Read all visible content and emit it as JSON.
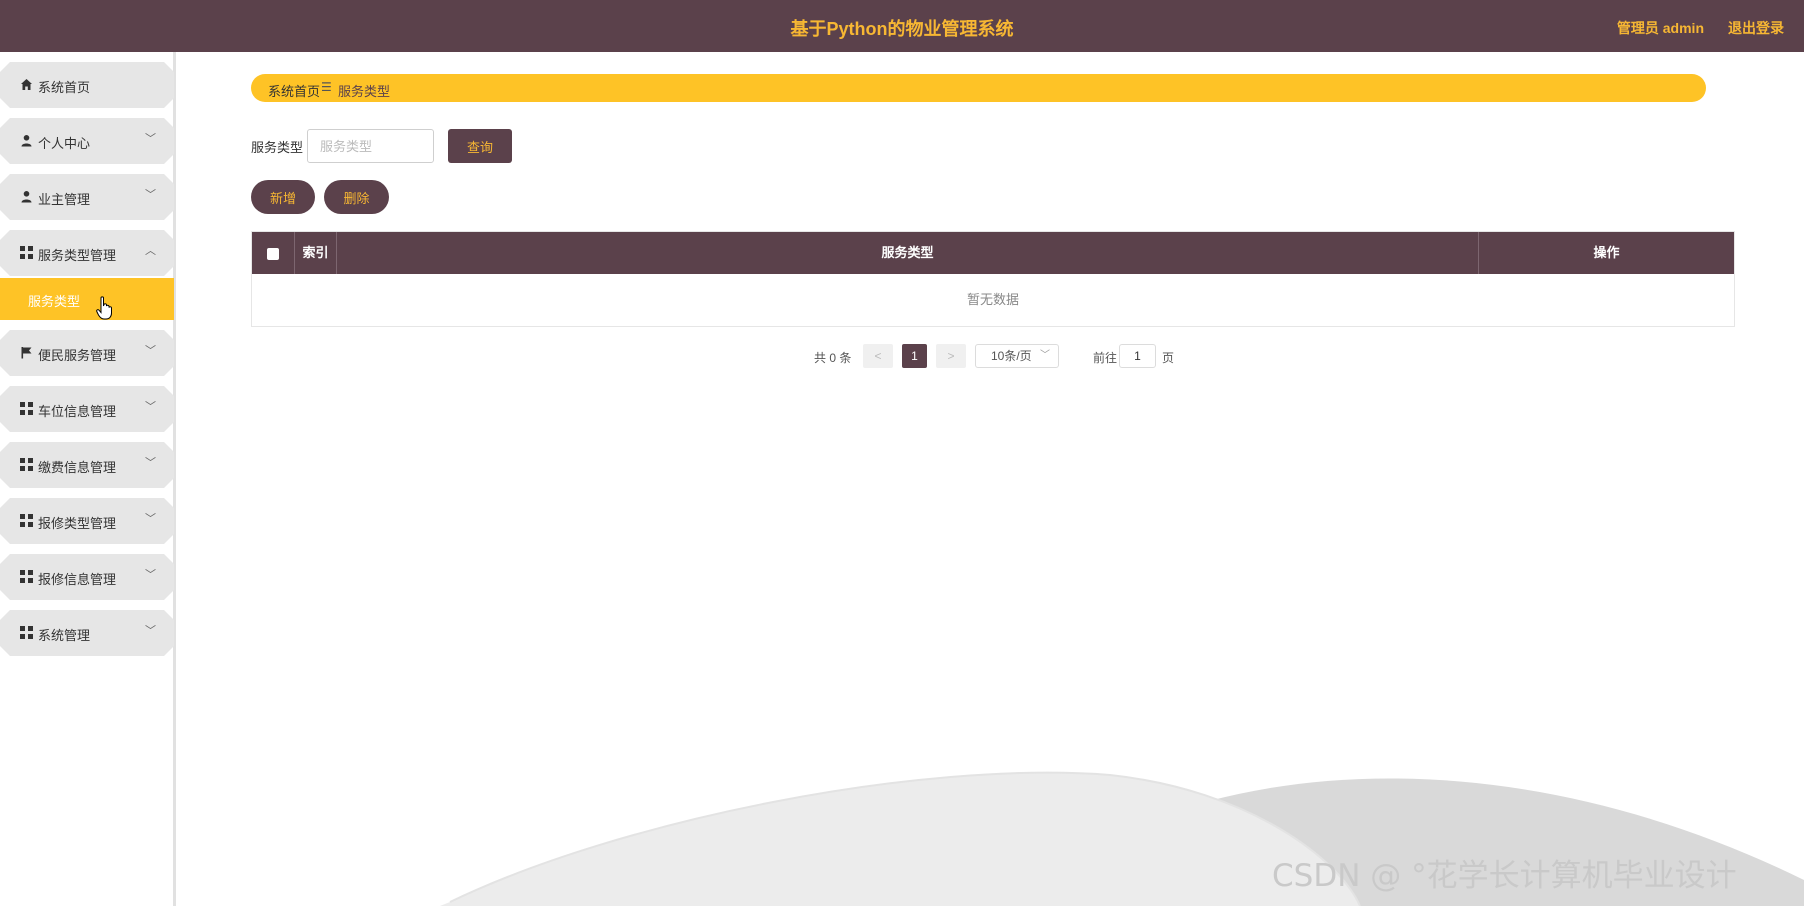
{
  "header": {
    "title": "基于Python的物业管理系统",
    "user": "管理员 admin",
    "logout": "退出登录"
  },
  "sidebar": {
    "items": [
      {
        "label": "系统首页",
        "icon": "home-icon"
      },
      {
        "label": "个人中心",
        "icon": "person-icon"
      },
      {
        "label": "业主管理",
        "icon": "person-icon"
      },
      {
        "label": "服务类型管理",
        "icon": "grid-icon"
      },
      {
        "label": "便民服务管理",
        "icon": "flag-icon"
      },
      {
        "label": "车位信息管理",
        "icon": "grid-icon"
      },
      {
        "label": "缴费信息管理",
        "icon": "grid-icon"
      },
      {
        "label": "报修类型管理",
        "icon": "grid-icon"
      },
      {
        "label": "报修信息管理",
        "icon": "grid-icon"
      },
      {
        "label": "系统管理",
        "icon": "grid-icon"
      }
    ],
    "sub_active": "服务类型"
  },
  "breadcrumb": {
    "home": "系统首页",
    "separator": "☰",
    "current": "服务类型"
  },
  "search": {
    "label": "服务类型",
    "placeholder": "服务类型",
    "button": "查询"
  },
  "actions": {
    "add": "新增",
    "delete": "删除"
  },
  "table": {
    "columns": [
      "",
      "索引",
      "服务类型",
      "操作"
    ],
    "empty_text": "暂无数据"
  },
  "pagination": {
    "total": "共 0 条",
    "prev": "<",
    "current_page": "1",
    "next": ">",
    "page_size": "10条/页",
    "goto_label": "前往",
    "goto_value": "1",
    "page_unit": "页"
  },
  "watermark": "CSDN @ °花学长计算机毕业设计",
  "colors": {
    "primary": "#5b414b",
    "accent": "#fec326",
    "header_text": "#f7b733"
  }
}
